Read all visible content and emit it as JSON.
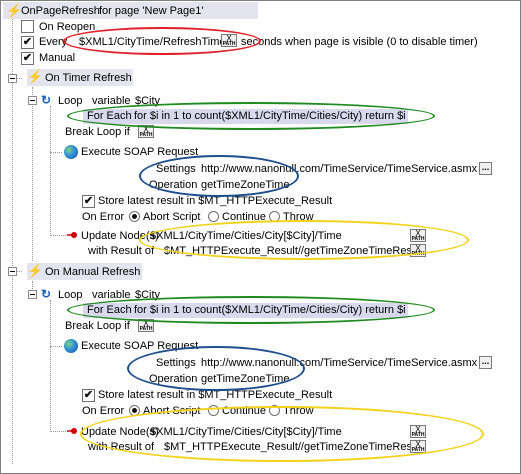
{
  "on_page_refresh": {
    "title": "OnPageRefresh",
    "for_page": "for page 'New Page1'",
    "on_reopen_label": "On Reopen",
    "every_label": "Every",
    "refresh_expr": "$XML1/CityTime/RefreshTime",
    "seconds_label": "seconds when page is visible (0 to disable timer)",
    "manual_label": "Manual",
    "on_reopen_checked": false,
    "every_checked": true,
    "manual_checked": true
  },
  "timer_refresh": {
    "title": "On Timer Refresh",
    "loop": {
      "label": "Loop",
      "variable_label": "variable",
      "variable": "$City",
      "for_each_label": "For Each",
      "for_each_expr": "for $i in 1 to count($XML1/CityTime/Cities/City) return $i",
      "break_label": "Break Loop if"
    },
    "soap": {
      "title": "Execute SOAP Request",
      "settings_label": "Settings",
      "settings_value": "http://www.nanonull.com/TimeService/TimeService.asmx",
      "operation_label": "Operation",
      "operation_value": "getTimeZoneTime",
      "store_label": "Store latest result in $MT_HTTPExecute_Result",
      "on_error_label": "On Error",
      "abort_label": "Abort Script",
      "continue_label": "Continue",
      "throw_label": "Throw"
    },
    "update": {
      "label": "Update Node(s)",
      "node_expr": "$XML1/CityTime/Cities/City[$City]/Time",
      "with_result_label": "with Result of",
      "result_expr": "$MT_HTTPExecute_Result//getTimeZoneTimeResult"
    }
  },
  "manual_refresh": {
    "title": "On Manual Refresh",
    "loop": {
      "label": "Loop",
      "variable_label": "variable",
      "variable": "$City",
      "for_each_label": "For Each",
      "for_each_expr": "for $i in 1 to count($XML1/CityTime/Cities/City) return $i",
      "break_label": "Break Loop if"
    },
    "soap": {
      "title": "Execute SOAP Request",
      "settings_label": "Settings",
      "settings_value": "http://www.nanonull.com/TimeService/TimeService.asmx",
      "operation_label": "Operation",
      "operation_value": "getTimeZoneTime",
      "store_label": "Store latest result in $MT_HTTPExecute_Result",
      "on_error_label": "On Error",
      "abort_label": "Abort Script",
      "continue_label": "Continue",
      "throw_label": "Throw"
    },
    "update": {
      "label": "Update Node(s)",
      "node_expr": "$XML1/CityTime/Cities/City[$City]/Time",
      "with_result_label": "with Result of",
      "result_expr": "$MT_HTTPExecute_Result//getTimeZoneTimeResult"
    }
  },
  "xpath_button": {
    "x": "X",
    "p": "PATH"
  },
  "dots_button": "...",
  "check_mark": "✔",
  "colors": {
    "red_highlight": "#e0202a",
    "green_highlight": "#1f8a1f",
    "blue_highlight": "#1f4e8c",
    "yellow_highlight": "#f2d21b",
    "header_bg": "#e4e4ee",
    "foreach_bg": "#d9d9ee",
    "bolt": "#e6a100"
  },
  "icons": [
    "lightning-icon",
    "lightning-pause-icon",
    "loop-icon",
    "globe-icon",
    "update-arrow-icon"
  ]
}
